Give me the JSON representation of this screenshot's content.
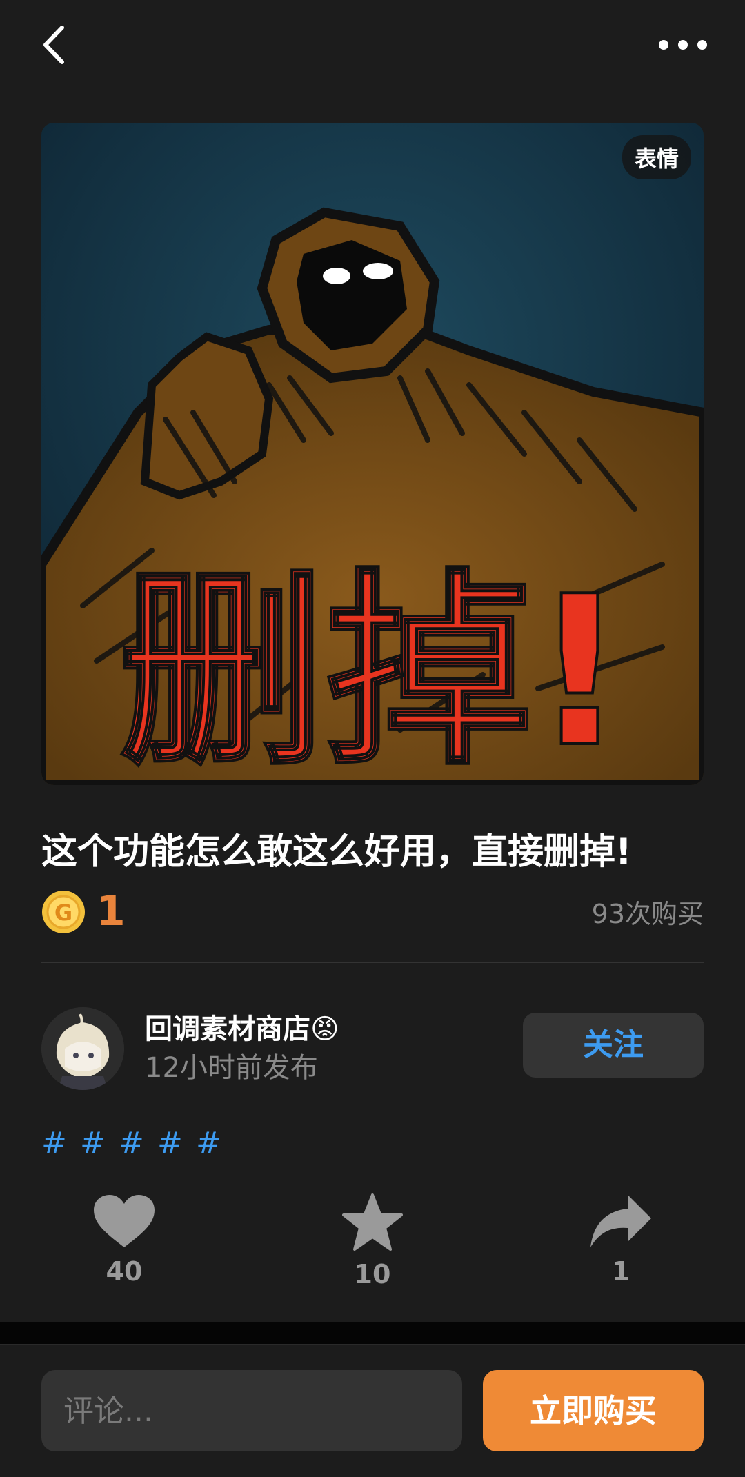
{
  "header": {
    "back_icon": "chevron-left-icon",
    "more_icon": "more-horizontal-icon"
  },
  "post": {
    "image_badge": "表情",
    "image_caption": "删掉!",
    "title": "这个功能怎么敢这么好用，直接删掉!",
    "price": "1",
    "coin_icon": "coin-g-icon",
    "purchases": "93次购买"
  },
  "author": {
    "name": "回调素材商店😡",
    "time": "12小时前发布",
    "follow_label": "关注"
  },
  "tags": [
    "#",
    "#",
    "#",
    "#",
    "#"
  ],
  "actions": {
    "like_count": "40",
    "favorite_count": "10",
    "share_count": "1"
  },
  "bottom": {
    "comment_placeholder": "评论...",
    "buy_label": "立即购买"
  },
  "colors": {
    "background": "#1c1c1c",
    "accent_orange": "#ef8a36",
    "price_orange": "#e9843c",
    "link_blue": "#3d9bf0",
    "muted_gray": "#8a8a8a"
  }
}
